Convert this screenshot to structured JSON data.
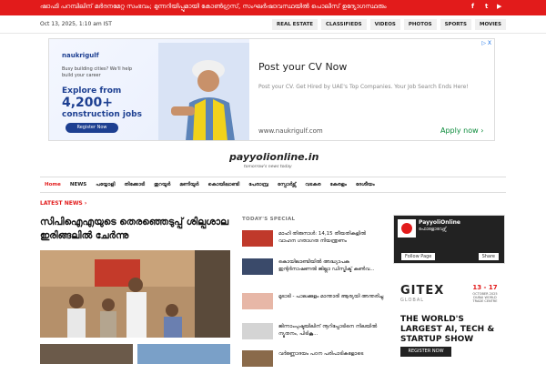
{
  "topbar": {
    "ticker": "ഷാഫി പറമ്പിലിന് മർദനമേറ്റ സംഭവം; മുന്നറിയിപ്പുമായി കോൺഗ്രസ്, സംഘർഷാവസ്ഥയിൽ പൊലീസ് ഉദ്യോഗസ്ഥരും",
    "social": [
      "f",
      "t",
      "▶"
    ]
  },
  "date": "Oct 13, 2025, 1:10 am IST",
  "topnav": [
    "REAL ESTATE",
    "CLASSIFIEDS",
    "VIDEOS",
    "PHOTOS",
    "SPORTS",
    "MOVIES"
  ],
  "ad": {
    "logo": "naukrigulf",
    "small": "Busy building cities? We'll help build your career",
    "explore": "Explore from",
    "count": "4,200+",
    "jobs": "construction jobs",
    "register": "Register Now",
    "title": "Post your CV Now",
    "desc": "Post your CV. Get Hired by UAE's Top Companies. Your Job Search Ends Here!",
    "url": "www.naukrigulf.com",
    "apply": "Apply now",
    "choice": "▷ X"
  },
  "logo": {
    "name": "payyolionline.in",
    "tagline": "tomorrow's news today"
  },
  "mainnav": [
    "Home",
    "NEWS",
    "പയ്യോളി",
    "തിക്കോടി",
    "തുറയൂർ",
    "മണിയൂർ",
    "കൊയിലാണ്ടി",
    "പേരാമ്പ്ര",
    "സ്പോർട്സ്",
    "വടകര",
    "കേരളം",
    "ദേശീയം"
  ],
  "latest": "LATEST NEWS",
  "headline": "സിപിഐഎയുടെ തെരഞ്ഞെടുപ്പ് ശില്പശാല ഇരിങ്ങലിൽ ചേർന്നു",
  "special": {
    "title": "TODAY'S SPECIAL",
    "items": [
      "മാഹി തിരുനാൾ: 14,15 തീയതികളിൽ വാഹന ഗതാഗത നിയന്ത്രണം",
      "കൊയിലാണ്ടിയിൽ അദ്ധ്യാപക ഇന്റർനാഷണൽ ജില്ലാ ഡിസ്ട്രിക്ട് കൺവ...",
      "മൂടാടി - പാലക്കുളം മാന്താരി ആര്യയി അന്തരിച്ചു",
      "ജിന്നാംപുഷ്ടയിലിന് നൂറിപ്പോടിനെ നിലയിൽ ന്യൂതനം, പിടികൂ...",
      "വർണ്ണോദയം പഠന പരിപാടികളോടെ"
    ]
  },
  "fb": {
    "name": "PayyoliOnline",
    "followers": "ഫോളോവേഴ്സ്",
    "follow": "Follow Page",
    "share": "Share"
  },
  "gitex": {
    "brand": "GITEX",
    "global": "GLOBAL",
    "dates": "13 - 17",
    "month": "OCTOBER 2025 DUBAI WORLD TRADE CENTRE",
    "headline": "THE WORLD'S LARGEST AI, TECH & STARTUP SHOW",
    "button": "REGISTER NOW"
  },
  "colors": {
    "accent": "#e21b1b",
    "ad_blue": "#1d3f91"
  }
}
